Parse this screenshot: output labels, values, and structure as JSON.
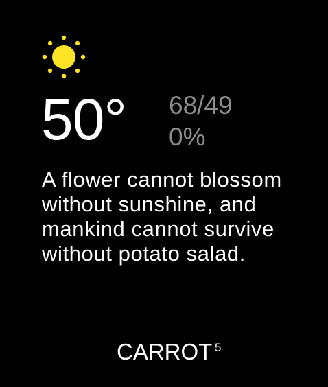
{
  "weather": {
    "icon": "sun-icon",
    "icon_color": "#FFE325",
    "temperature": "50°",
    "high_low": "68/49",
    "precipitation": "0%"
  },
  "message": {
    "text": "A flower cannot blossom without sunshine, and mankind cannot survive without potato salad."
  },
  "brand": {
    "name": "CARROT",
    "superscript": "5"
  },
  "colors": {
    "background": "#000000",
    "primary_text": "#FFFFFF",
    "secondary_text": "#8D8D8D"
  }
}
